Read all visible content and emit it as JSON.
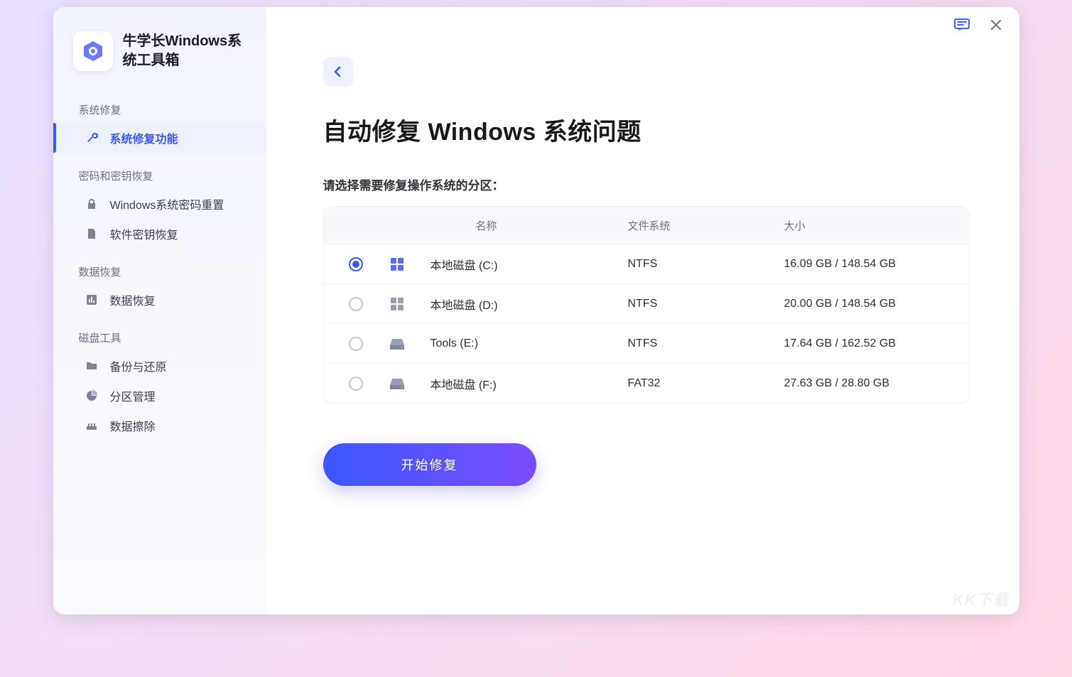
{
  "app": {
    "title": "牛学长Windows系统工具箱"
  },
  "sidebar": {
    "sections": [
      {
        "label": "系统修复",
        "items": [
          {
            "label": "系统修复功能",
            "icon": "wrench-icon",
            "active": true
          }
        ]
      },
      {
        "label": "密码和密钥恢复",
        "items": [
          {
            "label": "Windows系统密码重置",
            "icon": "lock-icon",
            "active": false
          },
          {
            "label": "软件密钥恢复",
            "icon": "key-file-icon",
            "active": false
          }
        ]
      },
      {
        "label": "数据恢复",
        "items": [
          {
            "label": "数据恢复",
            "icon": "bar-chart-icon",
            "active": false
          }
        ]
      },
      {
        "label": "磁盘工具",
        "items": [
          {
            "label": "备份与还原",
            "icon": "folder-icon",
            "active": false
          },
          {
            "label": "分区管理",
            "icon": "pie-chart-icon",
            "active": false
          },
          {
            "label": "数据擦除",
            "icon": "eraser-icon",
            "active": false
          }
        ]
      }
    ]
  },
  "main": {
    "back_label": "返回",
    "title": "自动修复 Windows 系统问题",
    "subtitle": "请选择需要修复操作系统的分区：",
    "columns": {
      "name": "名称",
      "fs": "文件系统",
      "size": "大小"
    },
    "partitions": [
      {
        "name": "本地磁盘 (C:)",
        "fs": "NTFS",
        "size": "16.09 GB / 148.54 GB",
        "icon": "os",
        "selected": true
      },
      {
        "name": "本地磁盘 (D:)",
        "fs": "NTFS",
        "size": "20.00 GB / 148.54 GB",
        "icon": "os",
        "selected": false
      },
      {
        "name": "Tools (E:)",
        "fs": "NTFS",
        "size": "17.64 GB / 162.52 GB",
        "icon": "drive",
        "selected": false
      },
      {
        "name": "本地磁盘 (F:)",
        "fs": "FAT32",
        "size": "27.63 GB / 28.80 GB",
        "icon": "drive",
        "selected": false
      }
    ],
    "start_label": "开始修复"
  },
  "watermark": "KK下载",
  "colors": {
    "primary": "#3a57ff",
    "primary_gradient_end": "#7a4dff"
  }
}
